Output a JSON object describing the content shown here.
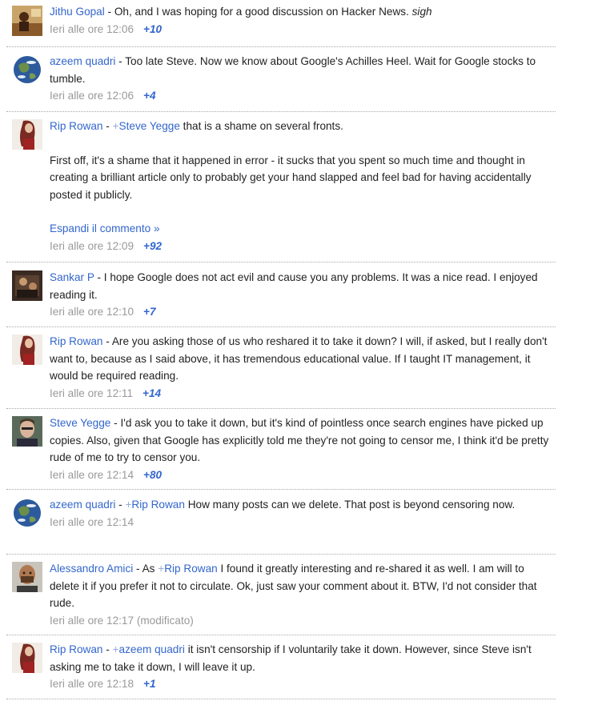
{
  "comments": [
    {
      "author": "Jithu Gopal",
      "sep": " - ",
      "text": "Oh, and I was hoping for a good discussion on Hacker News. ",
      "text_italic": "sigh",
      "time": "Ieri alle ore 12:06",
      "plusones": "+10"
    },
    {
      "author": "azeem quadri",
      "sep": " - ",
      "text": "Too late Steve. Now we know about Google's Achilles Heel. Wait for Google stocks to tumble.",
      "time": "Ieri alle ore 12:06",
      "plusones": "+4"
    },
    {
      "author": "Rip Rowan",
      "sep": " - ",
      "mention_prefix": "+",
      "mention": "Steve Yegge",
      "text": " that is a shame on several fronts.",
      "para2": "First off, it's a shame that it happened in error - it sucks that you spent so much time and thought in creating a brilliant article only to probably get your hand slapped and feel bad for having accidentally posted it publicly.",
      "expand": "Espandi il commento »",
      "time": "Ieri alle ore 12:09",
      "plusones": "+92"
    },
    {
      "author": "Sankar P",
      "sep": " - ",
      "text": "I hope Google does not act evil and cause you any problems. It was a nice read. I enjoyed reading it.",
      "time": "Ieri alle ore 12:10",
      "plusones": "+7"
    },
    {
      "author": "Rip Rowan",
      "sep": " - ",
      "text": "Are you asking those of us who reshared it to take it down? I will, if asked, but I really don't want to, because as I said above, it has tremendous educational value. If I taught IT management, it would be required reading.",
      "time": "Ieri alle ore 12:11",
      "plusones": "+14"
    },
    {
      "author": "Steve Yegge",
      "sep": " - ",
      "text": "I'd ask you to take it down, but it's kind of pointless once search engines have picked up copies. Also, given that Google has explicitly told me they're not going to censor me, I think it'd be pretty rude of me to try to censor you.",
      "time": "Ieri alle ore 12:14",
      "plusones": "+80"
    },
    {
      "author": "azeem quadri",
      "sep": " - ",
      "mention_prefix": "+",
      "mention": "Rip Rowan",
      "text": " How many posts can we delete. That post is beyond censoring now.",
      "time": "Ieri alle ore 12:14"
    },
    {
      "author": "Alessandro Amici",
      "sep": " - As ",
      "mention_prefix": "+",
      "mention": "Rip Rowan",
      "text": " I found it greatly interesting and re-shared it as well. I am will to delete it if you prefer it not to circulate. Ok, just saw your comment about it. BTW, I'd not consider that rude.",
      "time": "Ieri alle ore 12:17 (modificato)"
    },
    {
      "author": "Rip Rowan",
      "sep": " - ",
      "mention_prefix": "+",
      "mention": "azeem quadri",
      "text": " it isn't censorship if I voluntarily take it down. However, since Steve isn't asking me to take it down, I will leave it up.",
      "time": "Ieri alle ore 12:18",
      "plusones": "+1"
    }
  ],
  "colors": {
    "link": "#3366cc",
    "meta": "#999999",
    "text": "#222222",
    "divider": "#aaaaaa"
  }
}
